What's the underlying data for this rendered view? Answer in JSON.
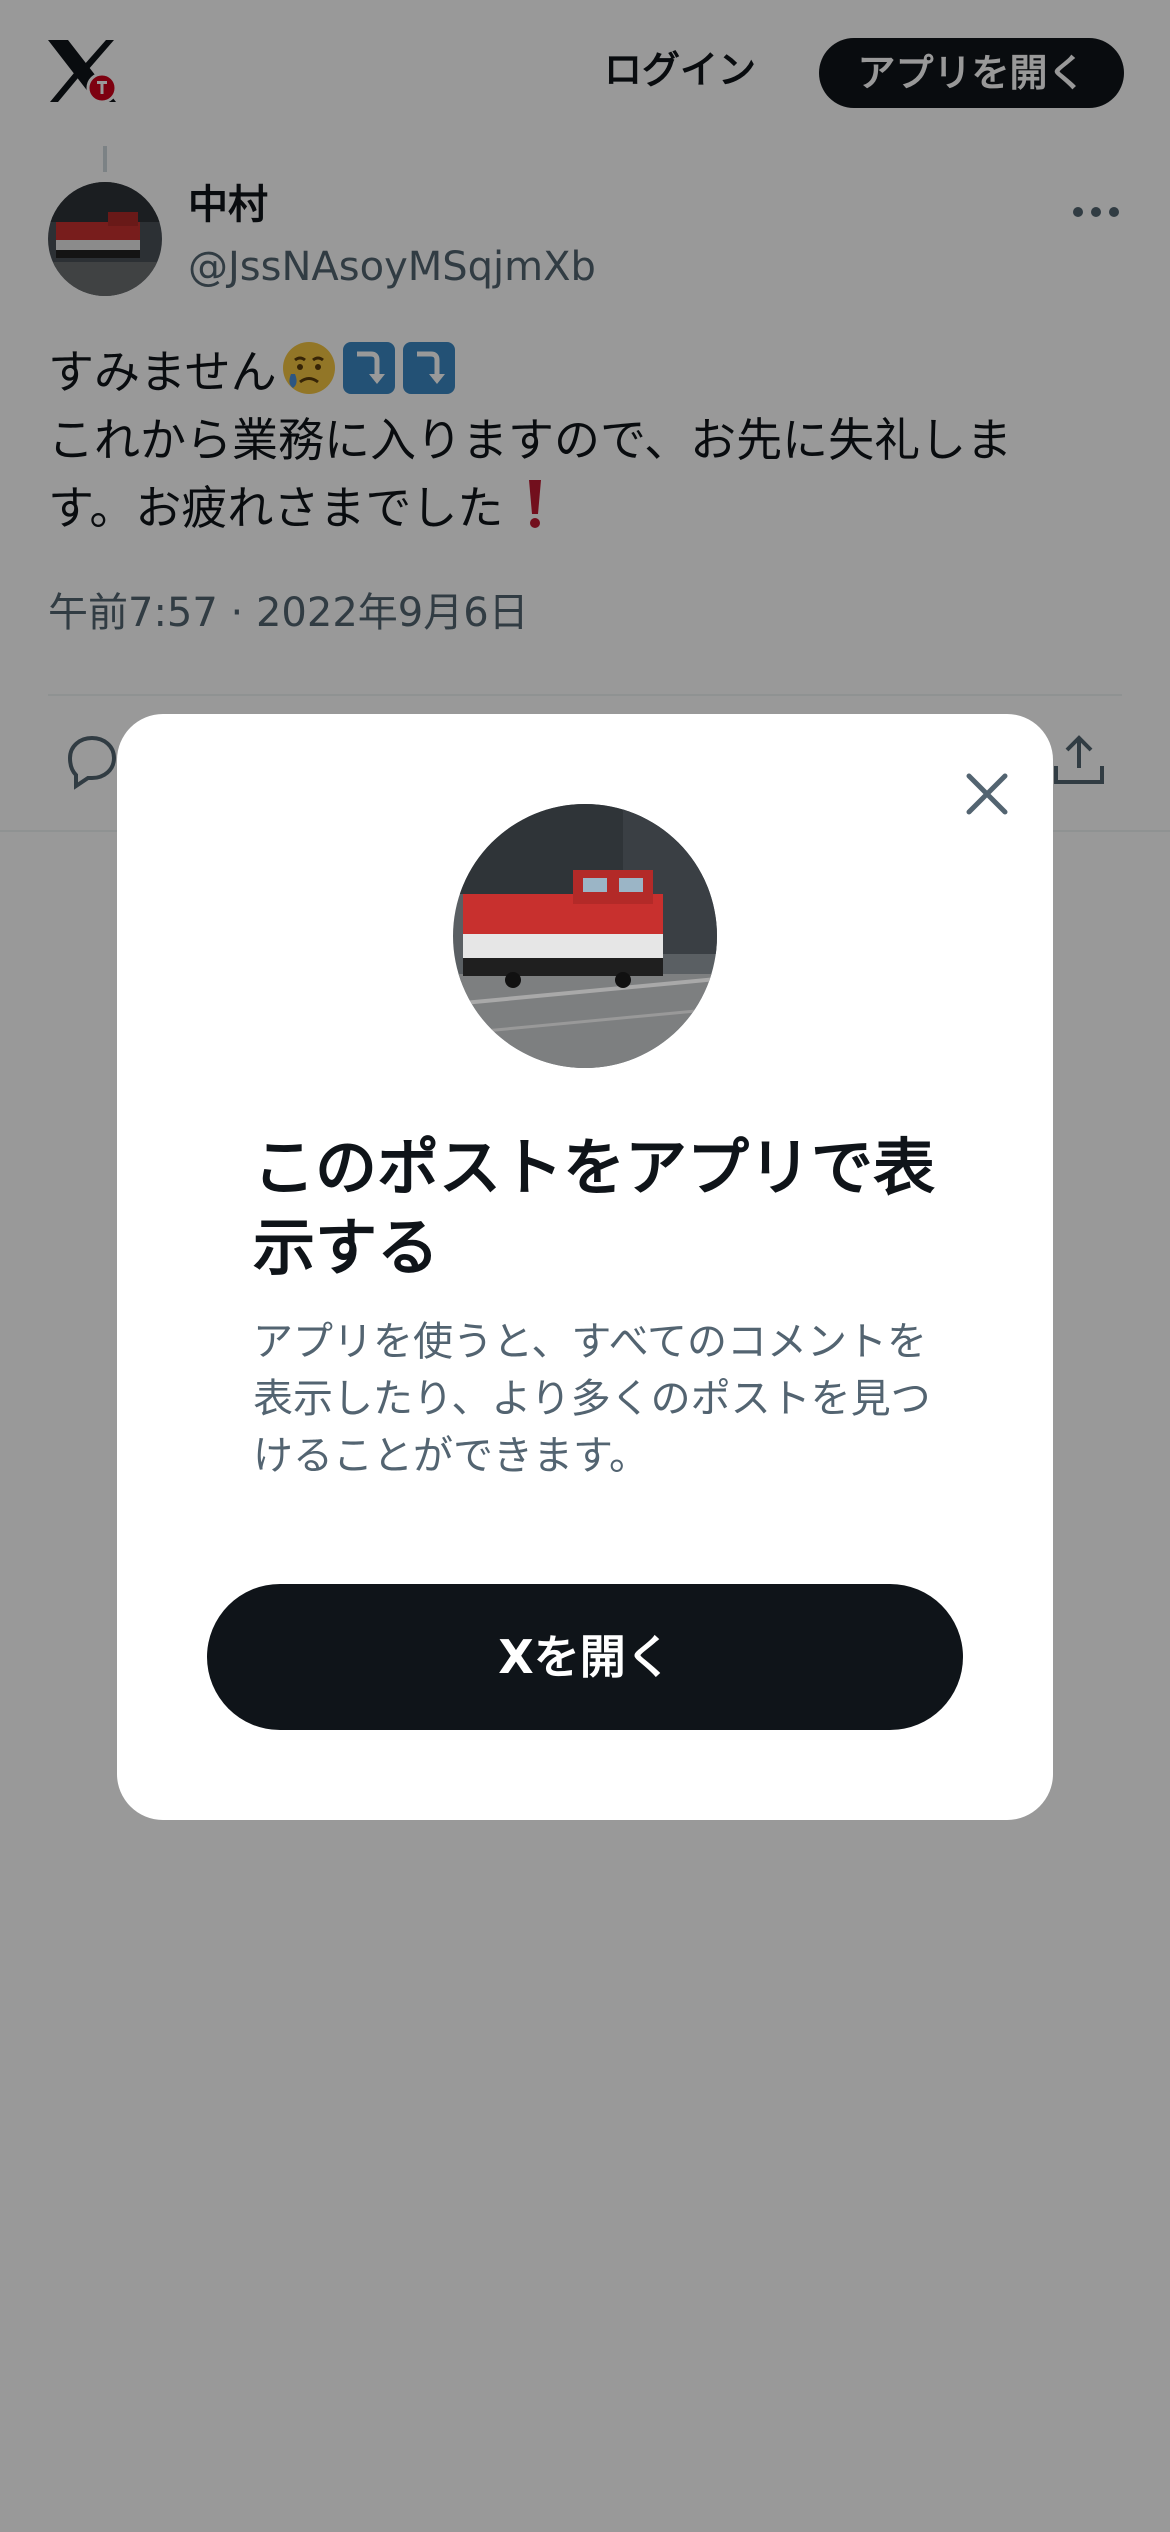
{
  "header": {
    "logo_icon": "x-logo-icon",
    "login_label": "ログイン",
    "open_app_label": "アプリを開く"
  },
  "tweet": {
    "display_name": "中村",
    "handle": "@JssNAsoyMSqjmXb",
    "text_line1": "すみません",
    "text_line2": "これから業務に入りますので、お先に失礼しま",
    "text_line3_prefix": "す。お疲れさまでした",
    "emojis": [
      "crying-face-emoji",
      "right-arrow-curving-down-emoji",
      "right-arrow-curving-down-emoji",
      "exclamation-mark-emoji"
    ],
    "timestamp": "午前7:57 · 2022年9月6日",
    "actions": [
      "reply-icon",
      "share-icon"
    ]
  },
  "modal": {
    "close_icon": "close-icon",
    "title": "このポストをアプリで表示する",
    "description": "アプリを使うと、すべてのコメントを表示したり、より多くのポストを見つけることができます。",
    "open_button_label": "Xを開く"
  },
  "colors": {
    "primary_text": "#0f1419",
    "secondary_text": "#536471",
    "button_bg": "#0f1419",
    "button_text": "#ffffff",
    "overlay": "rgba(0,0,0,0.40)"
  }
}
